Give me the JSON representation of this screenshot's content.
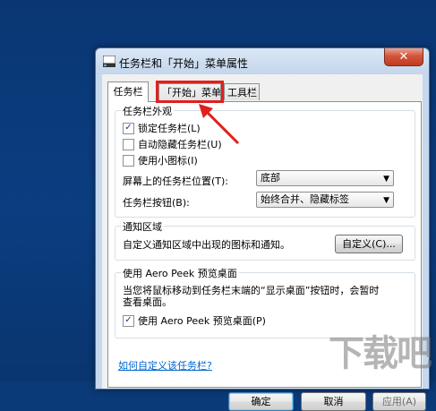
{
  "window": {
    "title": "任务栏和「开始」菜单属性",
    "close_symbol": "✕"
  },
  "tabs": [
    {
      "label": "任务栏",
      "active": true
    },
    {
      "label": "「开始」菜单",
      "active": false,
      "highlighted": true
    },
    {
      "label": "工具栏",
      "active": false
    }
  ],
  "appearance": {
    "group_label": "任务栏外观",
    "lock_taskbar": {
      "label": "锁定任务栏(L)",
      "checked": true
    },
    "auto_hide": {
      "label": "自动隐藏任务栏(U)",
      "checked": false
    },
    "small_icons": {
      "label": "使用小图标(I)",
      "checked": false
    },
    "position_label": "屏幕上的任务栏位置(T):",
    "position_value": "底部",
    "buttons_label": "任务栏按钮(B):",
    "buttons_value": "始终合并、隐藏标签"
  },
  "notification": {
    "group_label": "通知区域",
    "description": "自定义通知区域中出现的图标和通知。",
    "customize_button": "自定义(C)..."
  },
  "peek": {
    "group_label": "使用 Aero Peek 预览桌面",
    "description_line1": "当您将鼠标移动到任务栏末端的“显示桌面”按钮时，会暂时",
    "description_line2": "查看桌面。",
    "checkbox": {
      "label": "使用 Aero Peek 预览桌面(P)",
      "checked": true
    }
  },
  "help_link": "如何自定义该任务栏?",
  "footer": {
    "ok": "确定",
    "cancel": "取消",
    "apply": "应用(A)"
  },
  "watermark": "下载吧",
  "colors": {
    "desktop": "#0b3a78",
    "highlight": "#e0201d",
    "link": "#0066cc"
  }
}
